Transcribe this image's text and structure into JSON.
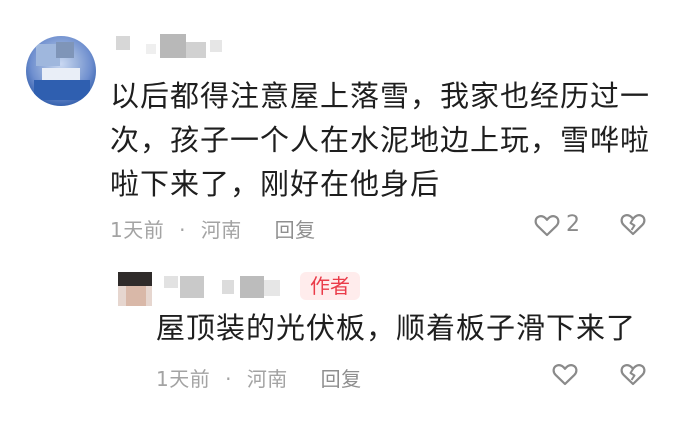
{
  "comment": {
    "text_lines": [
      "以后都得注意屋上落雪，我家也经历过一",
      "次，孩子一个人在水泥地边上玩，雪哗啦",
      "啦下来了，刚好在他身后"
    ],
    "time": "1天前",
    "separator": "·",
    "location": "河南",
    "reply_label": "回复",
    "like_count": "2",
    "heart_icon": "heart-outline-icon",
    "dislike_icon": "broken-heart-icon"
  },
  "reply": {
    "badge": "作者",
    "text": "屋顶装的光伏板，顺着板子滑下来了",
    "time": "1天前",
    "separator": "·",
    "location": "河南",
    "reply_label": "回复",
    "heart_icon": "heart-outline-icon",
    "dislike_icon": "broken-heart-icon"
  },
  "colors": {
    "text": "#1e1e1e",
    "meta": "#a3a3a3",
    "badge_bg": "#ffecec",
    "badge_text": "#ea3b49",
    "icon": "#8a8a8a"
  }
}
